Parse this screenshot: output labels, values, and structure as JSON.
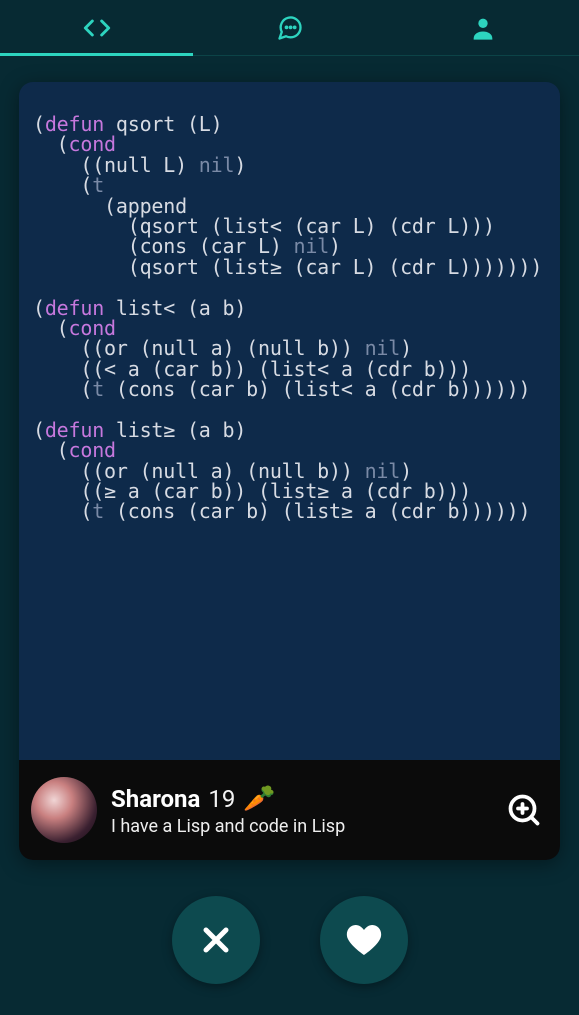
{
  "tabs": {
    "active_index": 0,
    "items": [
      "code",
      "chat",
      "profile"
    ]
  },
  "code": {
    "block1_l1_a": "(",
    "block1_l1_def": "defun",
    "block1_l1_b": " qsort (L)",
    "block1_l2_a": "  (",
    "block1_l2_cond": "cond",
    "block1_l3_a": "    ((null L) ",
    "block1_l3_nil": "nil",
    "block1_l3_b": ")",
    "block1_l4_a": "    (",
    "block1_l4_t": "t",
    "block1_l5": "      (append",
    "block1_l6": "        (qsort (list< (car L) (cdr L)))",
    "block1_l7_a": "        (cons (car L) ",
    "block1_l7_nil": "nil",
    "block1_l7_b": ")",
    "block1_l8": "        (qsort (list≥ (car L) (cdr L)))))))",
    "block2_l1_a": "(",
    "block2_l1_def": "defun",
    "block2_l1_b": " list< (a b)",
    "block2_l2_a": "  (",
    "block2_l2_cond": "cond",
    "block2_l3_a": "    ((or (null a) (null b)) ",
    "block2_l3_nil": "nil",
    "block2_l3_b": ")",
    "block2_l4": "    ((< a (car b)) (list< a (cdr b)))",
    "block2_l5_a": "    (",
    "block2_l5_t": "t",
    "block2_l5_b": " (cons (car b) (list< a (cdr b))))))",
    "block3_l1_a": "(",
    "block3_l1_def": "defun",
    "block3_l1_b": " list≥ (a b)",
    "block3_l2_a": "  (",
    "block3_l2_cond": "cond",
    "block3_l3_a": "    ((or (null a) (null b)) ",
    "block3_l3_nil": "nil",
    "block3_l3_b": ")",
    "block3_l4": "    ((≥ a (car b)) (list≥ a (cdr b)))",
    "block3_l5_a": "    (",
    "block3_l5_t": "t",
    "block3_l5_b": " (cons (car b) (list≥ a (cdr b))))))"
  },
  "profile": {
    "name": "Sharona",
    "age": "19",
    "emoji": "🥕",
    "bio": "I have a Lisp and code in Lisp"
  },
  "actions": {
    "reject": "reject",
    "like": "like"
  },
  "colors": {
    "bg": "#072a33",
    "card": "#0e2a4a",
    "accent": "#2dd4bf",
    "action_btn": "#0d4a4f"
  }
}
